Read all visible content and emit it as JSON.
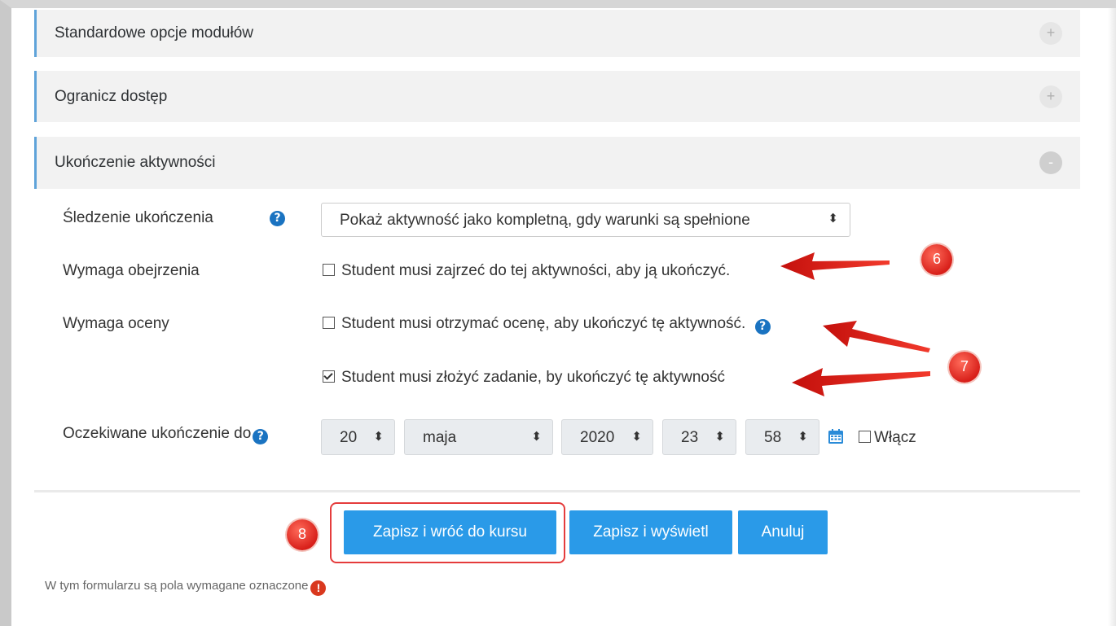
{
  "sections": [
    {
      "title": "Standardowe opcje modułów",
      "toggle": "+"
    },
    {
      "title": "Ogranicz dostęp",
      "toggle": "+"
    },
    {
      "title": "Ukończenie aktywności",
      "toggle": "-"
    }
  ],
  "completion": {
    "tracking_label": "Śledzenie ukończenia",
    "tracking_value": "Pokaż aktywność jako kompletną, gdy warunki są spełnione",
    "view_label": "Wymaga obejrzenia",
    "view_checkbox": "Student musi zajrzeć do tej aktywności, aby ją ukończyć.",
    "grade_label": "Wymaga oceny",
    "grade_checkbox": "Student musi otrzymać ocenę, aby ukończyć tę aktywność.",
    "submit_checkbox": "Student musi złożyć zadanie, by ukończyć tę aktywność",
    "expected_label": "Oczekiwane ukończenie do",
    "day": "20",
    "month": "maja",
    "year": "2020",
    "hour": "23",
    "minute": "58",
    "enable_label": "Włącz"
  },
  "badges": {
    "b6": "6",
    "b7": "7",
    "b8": "8"
  },
  "buttons": {
    "save_return": "Zapisz i wróć do kursu",
    "save_display": "Zapisz i wyświetl",
    "cancel": "Anuluj"
  },
  "footer": {
    "required_note": "W tym formularzu są pola wymagane oznaczone"
  },
  "icons": {
    "help": "question-circle-icon",
    "calendar": "calendar-icon",
    "required": "exclamation-circle-icon"
  },
  "colors": {
    "accent": "#2a9ae8",
    "help": "#1a73c1",
    "badge": "#d8201a",
    "arrow": "#e8241c"
  }
}
